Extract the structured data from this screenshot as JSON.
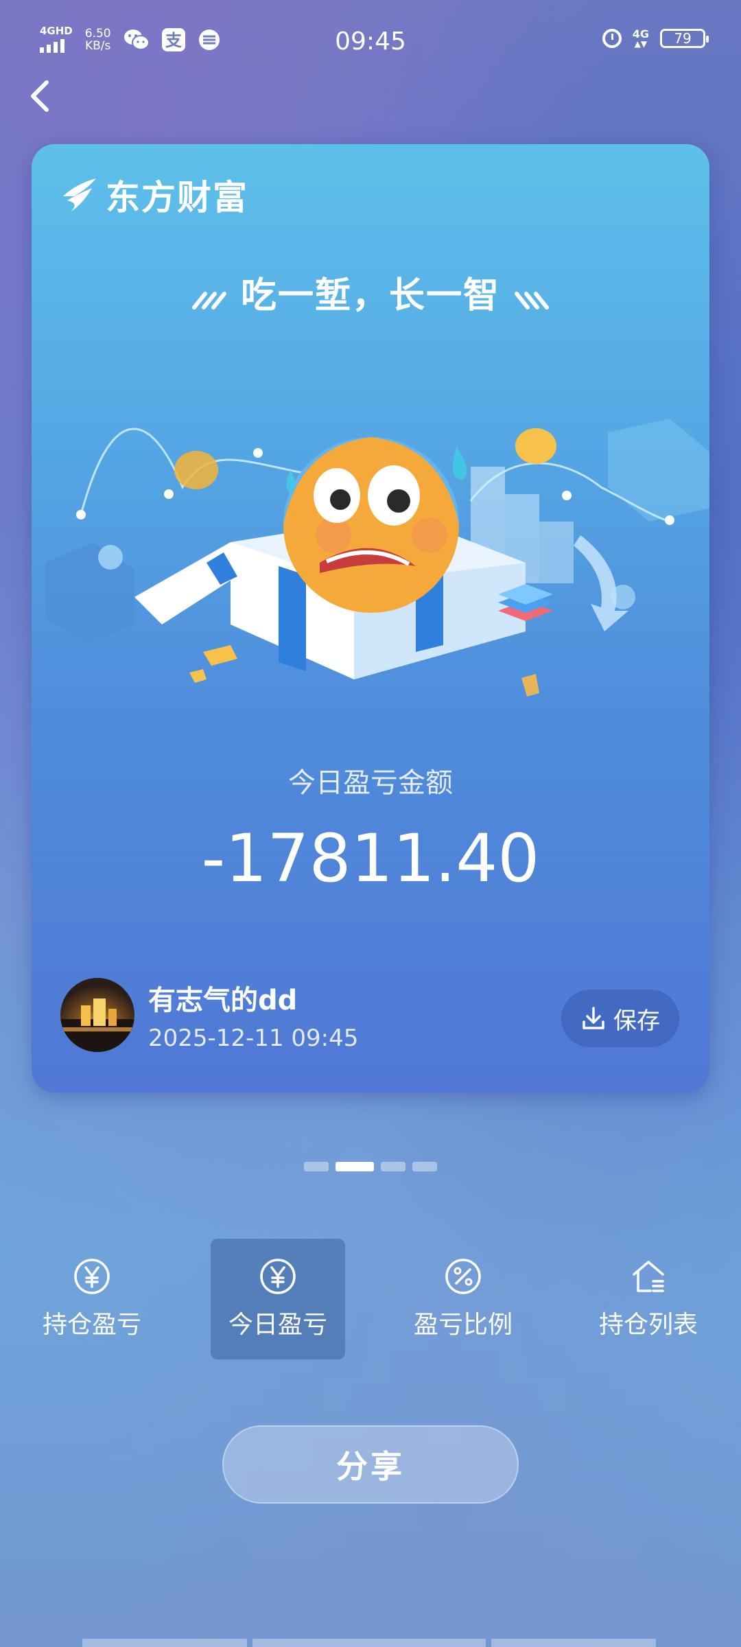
{
  "status_bar": {
    "network": "4GHD",
    "speed_value": "6.50",
    "speed_unit": "KB/s",
    "time": "09:45",
    "net_type": "4G",
    "battery": "79"
  },
  "card": {
    "brand": "东方财富",
    "slogan": "吃一堑，长一智",
    "amount_label": "今日盈亏金额",
    "amount": "-17811.40",
    "user_name": "有志气的dd",
    "timestamp": "2025-12-11 09:45",
    "save_label": "保存"
  },
  "pager": {
    "count": 4,
    "active": 1
  },
  "tabs": [
    {
      "label": "持仓盈亏",
      "icon": "yen-circle-icon",
      "active": false
    },
    {
      "label": "今日盈亏",
      "icon": "yen-circle-icon",
      "active": true
    },
    {
      "label": "盈亏比例",
      "icon": "percent-circle-icon",
      "active": false
    },
    {
      "label": "持仓列表",
      "icon": "house-list-icon",
      "active": false
    }
  ],
  "share_label": "分享"
}
